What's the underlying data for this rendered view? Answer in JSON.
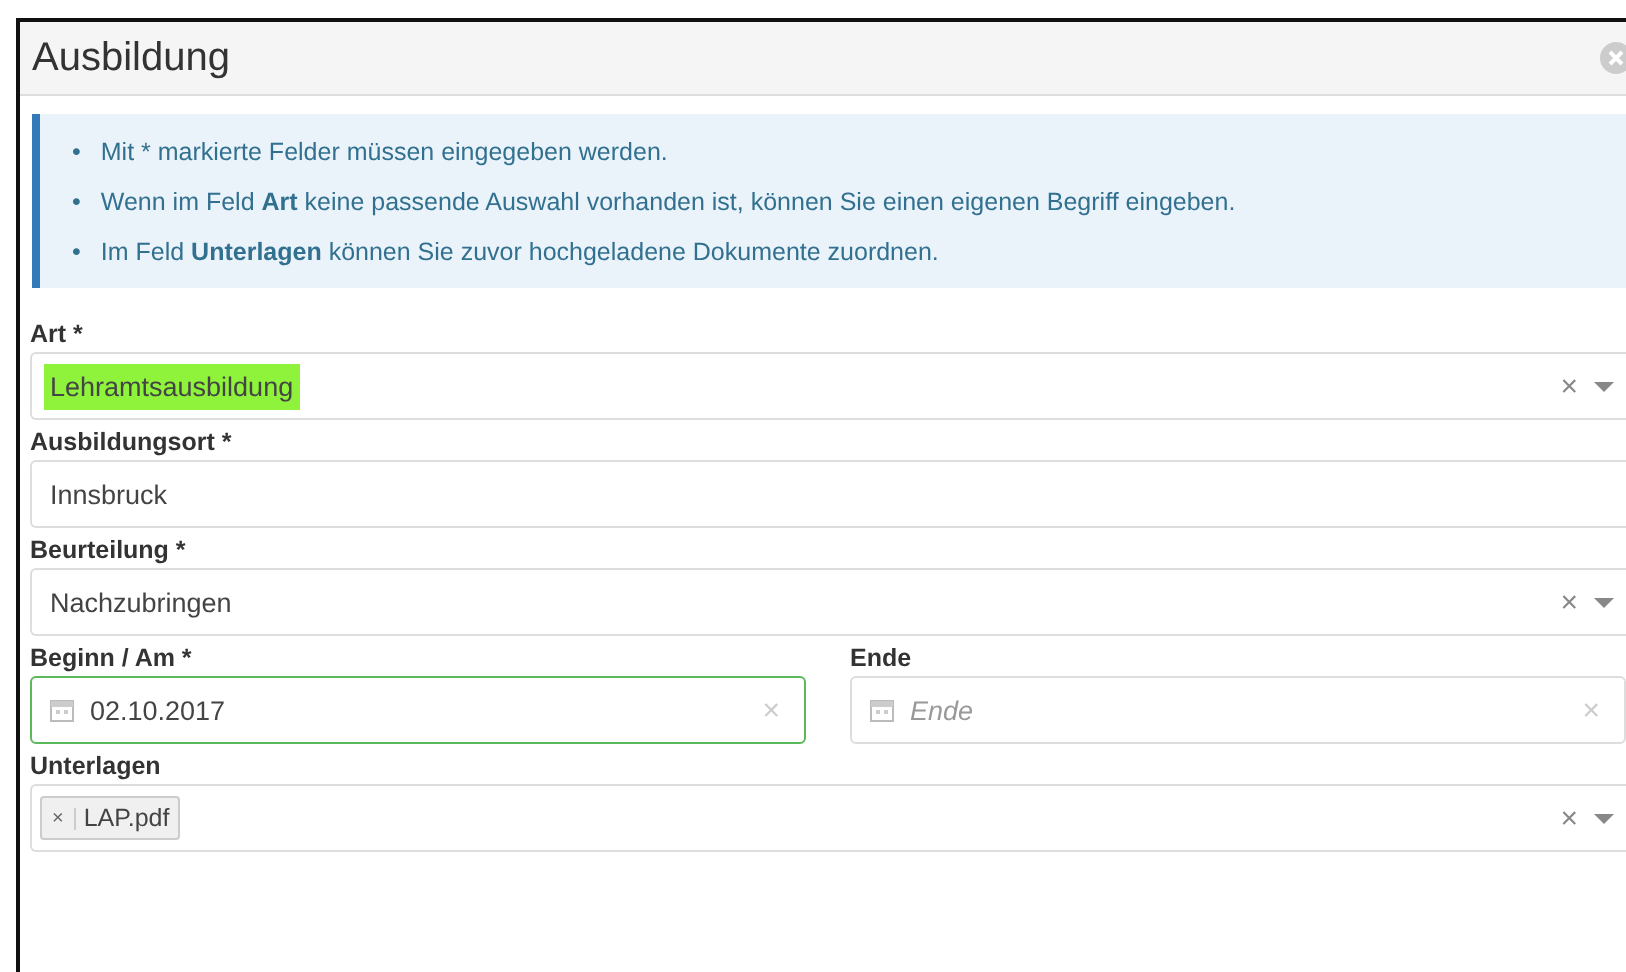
{
  "dialog": {
    "title": "Ausbildung"
  },
  "info": [
    {
      "bullet": "•",
      "text": "Mit * markierte Felder müssen eingegeben werden."
    },
    {
      "bullet": "•",
      "text": "Wenn im Feld **Art** keine passende Auswahl vorhanden ist, können Sie einen eigenen Begriff eingeben."
    },
    {
      "bullet": "•",
      "text": "Im Feld **Unterlagen** können Sie zuvor hochgeladene Dokumente zuordnen."
    }
  ],
  "rows": [
    [
      {
        "kind": "select",
        "label": "Art *",
        "value": "Lehramtsausbildung",
        "highlighted": true,
        "clear": "×"
      }
    ],
    [
      {
        "kind": "text",
        "label": "Ausbildungsort *",
        "value": "Innsbruck"
      }
    ],
    [
      {
        "kind": "select",
        "label": "Beurteilung *",
        "value": "Nachzubringen",
        "highlighted": false,
        "clear": "×"
      }
    ],
    [
      {
        "kind": "date",
        "label": "Beginn / Am *",
        "value": "02.10.2017",
        "valid": true,
        "clear": "×"
      },
      {
        "kind": "date",
        "label": "Ende",
        "placeholder": "Ende",
        "valid": false,
        "clear": "×"
      }
    ],
    [
      {
        "kind": "tags",
        "label": "Unterlagen",
        "tags": [
          {
            "remove": "×",
            "label": "LAP.pdf"
          }
        ],
        "clear": "×"
      }
    ]
  ]
}
